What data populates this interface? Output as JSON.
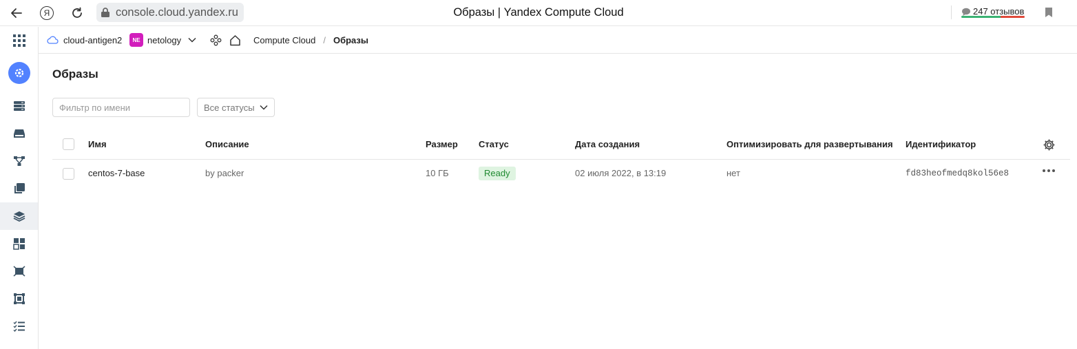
{
  "browser": {
    "url": "console.cloud.yandex.ru",
    "title": "Образы | Yandex Compute Cloud",
    "reviews": "247 отзывов",
    "yandex_glyph": "Я"
  },
  "header": {
    "cloud": "cloud-antigen2",
    "folder_badge": "NE",
    "folder": "netology",
    "breadcrumb_service": "Compute Cloud",
    "breadcrumb_sep": "/",
    "breadcrumb_current": "Образы"
  },
  "sidebar": {
    "items": [
      {
        "icon": "compute-cloud-icon",
        "active": false
      },
      {
        "icon": "virtual-machines-icon",
        "active": false
      },
      {
        "icon": "disks-icon",
        "active": false
      },
      {
        "icon": "placement-groups-icon",
        "active": false
      },
      {
        "icon": "snapshots-icon",
        "active": false
      },
      {
        "icon": "images-icon",
        "active": true
      },
      {
        "icon": "instance-groups-icon",
        "active": false
      },
      {
        "icon": "gpu-clusters-icon",
        "active": false
      },
      {
        "icon": "dedicated-hosts-icon",
        "active": false
      },
      {
        "icon": "operations-icon",
        "active": false
      }
    ]
  },
  "main": {
    "title": "Образы",
    "filter_placeholder": "Фильтр по имени",
    "status_select": "Все статусы"
  },
  "table": {
    "columns": [
      "Имя",
      "Описание",
      "Размер",
      "Статус",
      "Дата создания",
      "Оптимизировать для развертывания",
      "Идентификатор"
    ],
    "rows": [
      {
        "name": "centos-7-base",
        "description": "by packer",
        "size": "10 ГБ",
        "status": "Ready",
        "created": "02 июля 2022, в 13:19",
        "optimize": "нет",
        "id": "fd83heofmedq8kol56e8"
      }
    ]
  },
  "colors": {
    "accent": "#5282ff",
    "folder_badge": "#d21ebc",
    "ready_bg": "#dff4e1",
    "ready_text": "#1f8a30"
  }
}
